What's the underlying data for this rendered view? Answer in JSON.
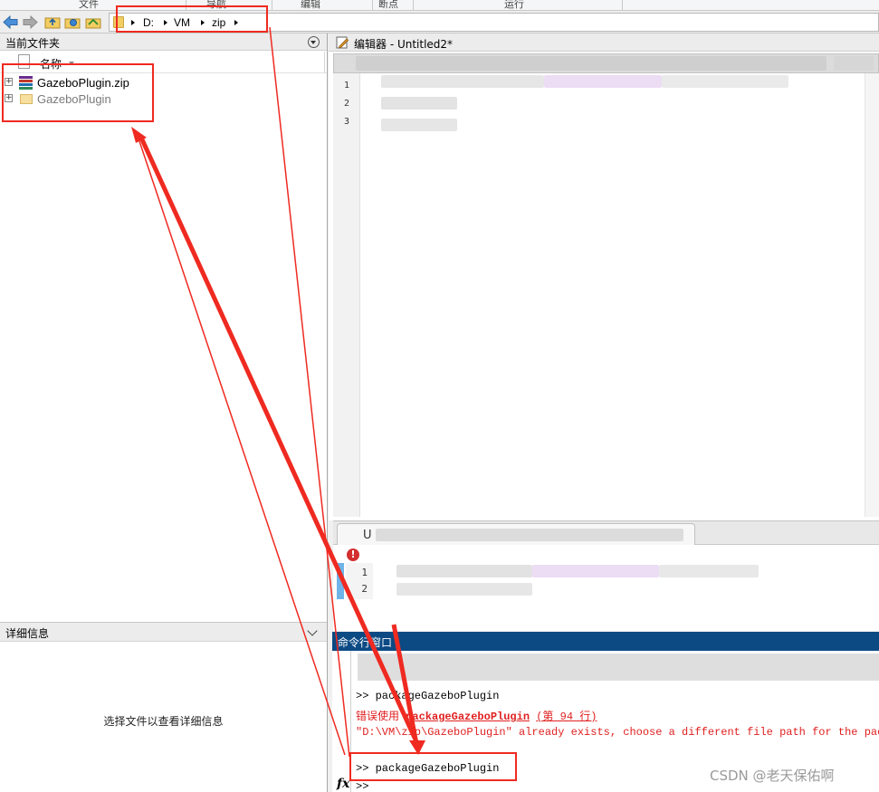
{
  "ribbon": {
    "tabs": [
      "文件",
      "导航",
      "编辑",
      "断点",
      "运行"
    ]
  },
  "address_bar": {
    "crumbs": [
      "D:",
      "VM",
      "zip"
    ]
  },
  "file_browser": {
    "title": "当前文件夹",
    "column_name": "名称",
    "items": [
      {
        "name": "GazeboPlugin.zip",
        "type": "zip"
      },
      {
        "name": "GazeboPlugin",
        "type": "folder"
      }
    ]
  },
  "details": {
    "title": "详细信息",
    "hint": "选择文件以查看详细信息"
  },
  "editor": {
    "title": "编辑器 - Untitled2*",
    "line_numbers": [
      "1",
      "2",
      "3"
    ]
  },
  "issues": {
    "tab_letter": "U",
    "error_icon": "!",
    "line_numbers": [
      "1",
      "2"
    ]
  },
  "command_window": {
    "title": "命令行窗口",
    "lines": {
      "cmd1": ">> packageGazeboPlugin",
      "err_prefix": "错误使用 ",
      "err_func": "packageGazeboPlugin",
      "err_location": "(第 94 行)",
      "err_message": "\"D:\\VM\\zip\\GazeboPlugin\" already exists, choose a different file path for the packa",
      "cmd2": ">> packageGazeboPlugin",
      "prompt": ">>"
    },
    "fx_label": "fx"
  },
  "watermark": "CSDN @老天保佑啊",
  "colors": {
    "annotation_red": "#ef2a21",
    "cmd_header_blue": "#0c4a84",
    "error_red": "#e02020"
  }
}
